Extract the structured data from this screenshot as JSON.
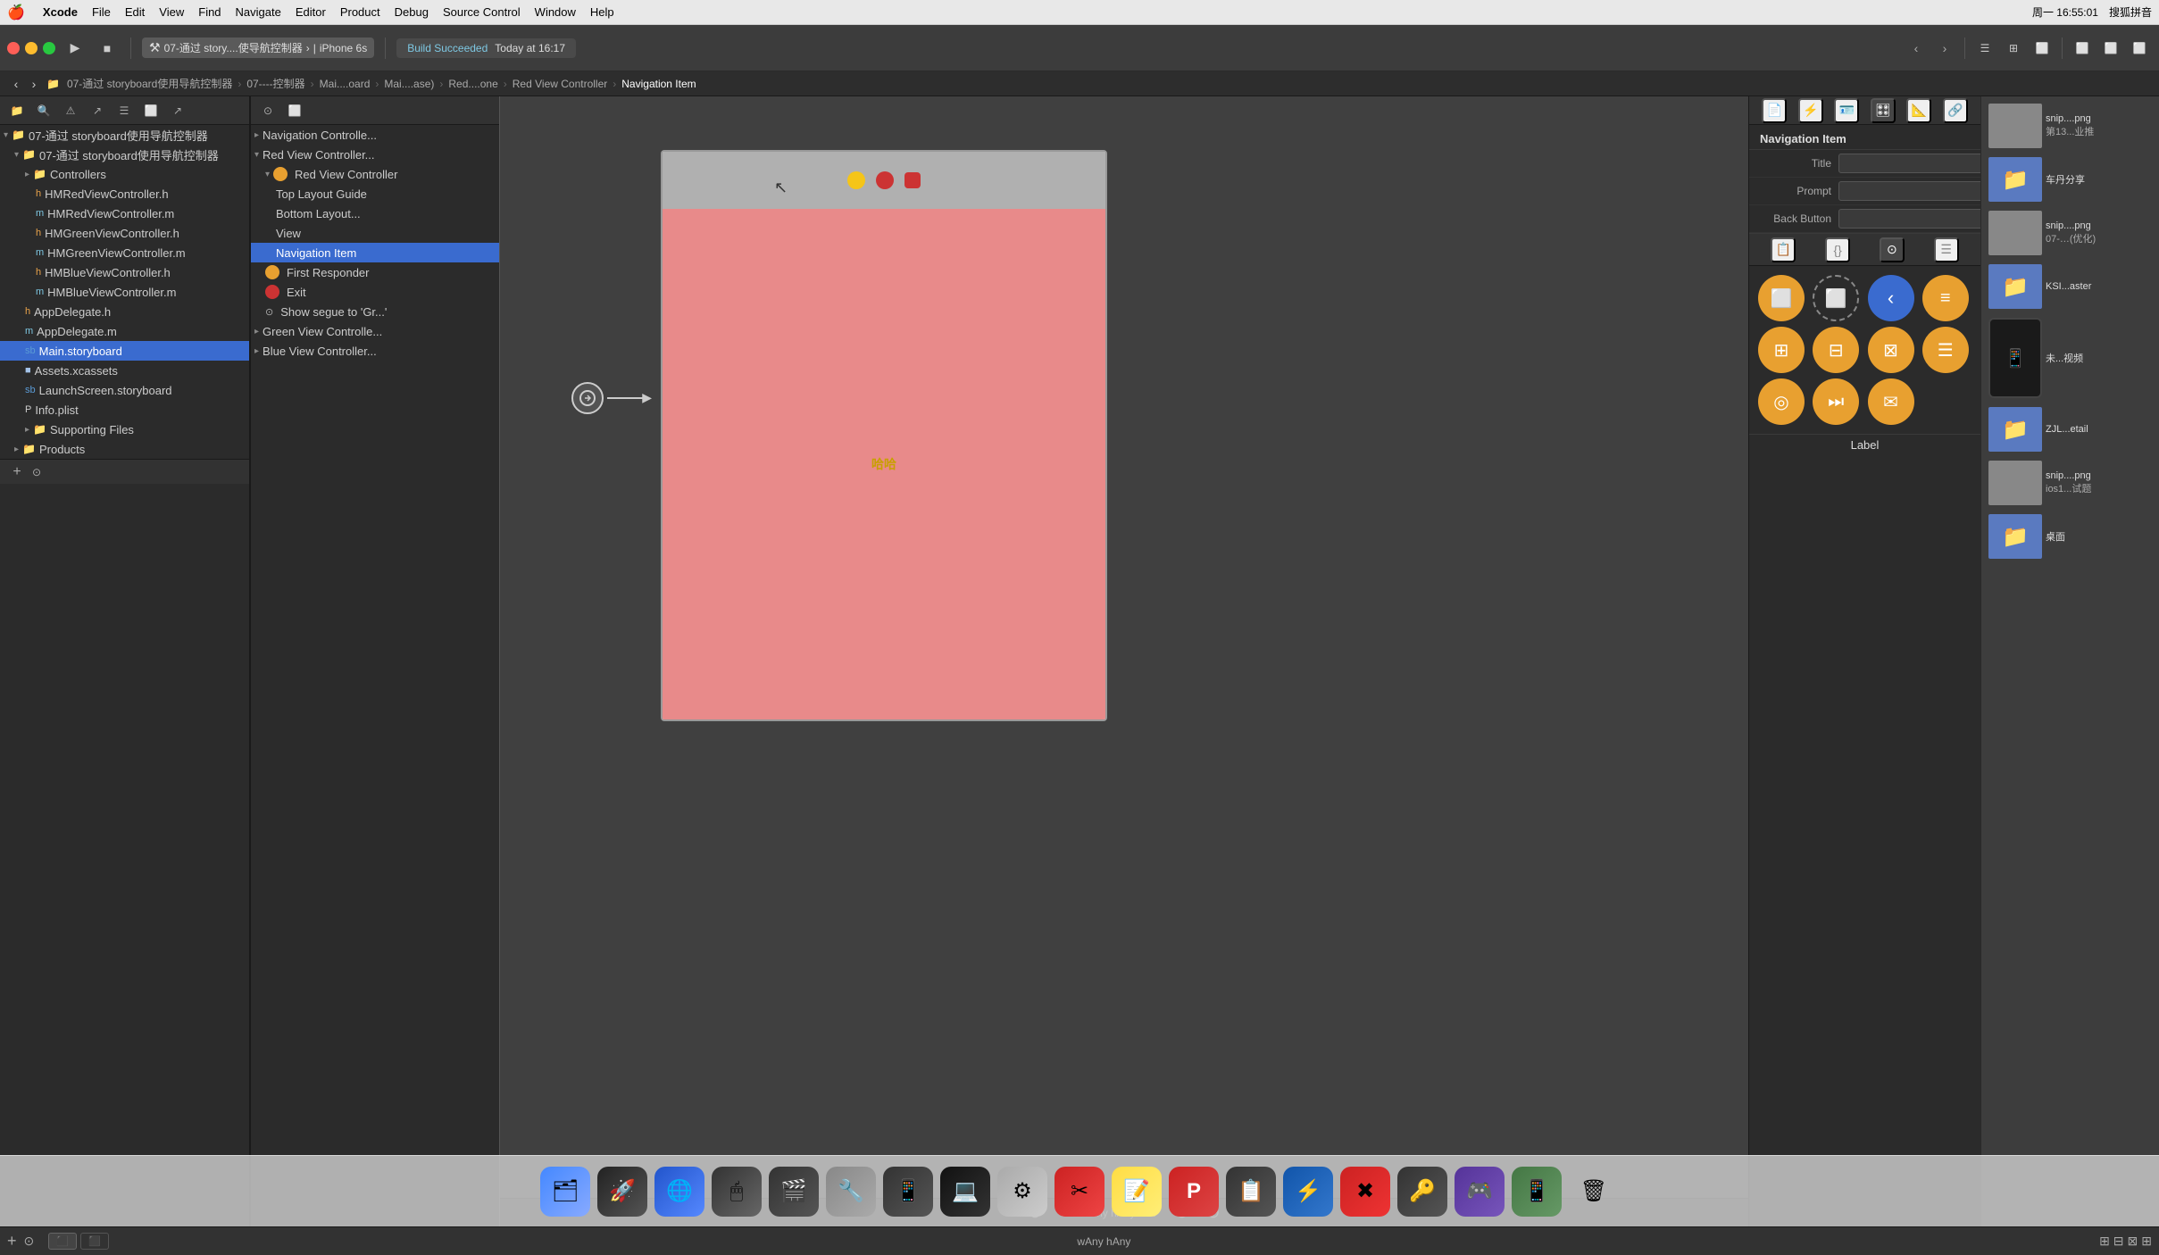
{
  "menubar": {
    "apple": "🍎",
    "items": [
      "Xcode",
      "File",
      "Edit",
      "View",
      "Find",
      "Navigate",
      "Editor",
      "Product",
      "Debug",
      "Source Control",
      "Window",
      "Help"
    ],
    "right": {
      "datetime": "周一 16:55:01",
      "input_method": "搜狐拼音"
    }
  },
  "toolbar": {
    "run_label": "▶",
    "stop_label": "■",
    "scheme": "07-通过 story....使导航控制器",
    "device": "iPhone 6s",
    "build_status": "Build Succeeded",
    "build_time": "Today at 16:17",
    "nav_prev": "‹",
    "nav_next": "›"
  },
  "breadcrumb": {
    "items": [
      "07-通过 storyboard使用导航控制器",
      "07----控制器",
      "Mai....oard",
      "Mai....ase)",
      "Red....one",
      "Red View Controller",
      "Navigation Item"
    ]
  },
  "sidebar": {
    "toolbar_icons": [
      "📁",
      "🔍",
      "⚠",
      "↗",
      "☰",
      "⬜",
      "↗"
    ],
    "tree": [
      {
        "id": "root",
        "label": "07-通过 storyboard使用导航控制器",
        "indent": 0,
        "type": "project",
        "expanded": true
      },
      {
        "id": "group1",
        "label": "07-通过 storyboard使用导航控制器",
        "indent": 1,
        "type": "group",
        "expanded": true
      },
      {
        "id": "controllers",
        "label": "Controllers",
        "indent": 2,
        "type": "group",
        "expanded": false
      },
      {
        "id": "hmred-h",
        "label": "HMRedViewController.h",
        "indent": 3,
        "type": "h"
      },
      {
        "id": "hmred-m",
        "label": "HMRedViewController.m",
        "indent": 3,
        "type": "m"
      },
      {
        "id": "hmgreen-h",
        "label": "HMGreenViewController.h",
        "indent": 3,
        "type": "h"
      },
      {
        "id": "hmgreen-m",
        "label": "HMGreenViewController.m",
        "indent": 3,
        "type": "m"
      },
      {
        "id": "hmblue-h",
        "label": "HMBlueViewController.h",
        "indent": 3,
        "type": "h"
      },
      {
        "id": "hmblue-m",
        "label": "HMBlueViewController.m",
        "indent": 3,
        "type": "m"
      },
      {
        "id": "appdelegate-h",
        "label": "AppDelegate.h",
        "indent": 2,
        "type": "h"
      },
      {
        "id": "appdelegate-m",
        "label": "AppDelegate.m",
        "indent": 2,
        "type": "m"
      },
      {
        "id": "main-storyboard",
        "label": "Main.storyboard",
        "indent": 2,
        "type": "storyboard",
        "selected": true
      },
      {
        "id": "assets",
        "label": "Assets.xcassets",
        "indent": 2,
        "type": "xcassets"
      },
      {
        "id": "launch-storyboard",
        "label": "LaunchScreen.storyboard",
        "indent": 2,
        "type": "storyboard"
      },
      {
        "id": "info-plist",
        "label": "Info.plist",
        "indent": 2,
        "type": "plist"
      },
      {
        "id": "supporting",
        "label": "Supporting Files",
        "indent": 2,
        "type": "group",
        "expanded": false
      },
      {
        "id": "products",
        "label": "Products",
        "indent": 1,
        "type": "group",
        "expanded": false
      }
    ]
  },
  "scene_tree": {
    "items": [
      {
        "id": "nav-controller",
        "label": "Navigation Controlle...",
        "indent": 0,
        "type": "controller",
        "expanded": false
      },
      {
        "id": "red-view-controller-group",
        "label": "Red View Controller...",
        "indent": 0,
        "type": "controller",
        "expanded": true
      },
      {
        "id": "red-view-controller",
        "label": "Red View Controller",
        "indent": 1,
        "type": "scene",
        "dot": "orange"
      },
      {
        "id": "top-layout",
        "label": "Top Layout Guide",
        "indent": 2,
        "type": "layout"
      },
      {
        "id": "bottom-layout",
        "label": "Bottom Layout...",
        "indent": 2,
        "type": "layout"
      },
      {
        "id": "view",
        "label": "View",
        "indent": 2,
        "type": "view"
      },
      {
        "id": "nav-item",
        "label": "Navigation Item",
        "indent": 2,
        "type": "navitem",
        "selected": true
      },
      {
        "id": "first-responder",
        "label": "First Responder",
        "indent": 1,
        "type": "responder",
        "dot": "orange"
      },
      {
        "id": "exit",
        "label": "Exit",
        "indent": 1,
        "type": "exit",
        "dot": "red"
      },
      {
        "id": "show-segue",
        "label": "Show segue to 'Gr...'",
        "indent": 1,
        "type": "segue"
      },
      {
        "id": "green-controller",
        "label": "Green View Controlle...",
        "indent": 0,
        "type": "controller",
        "expanded": false
      },
      {
        "id": "blue-controller",
        "label": "Blue View Controller...",
        "indent": 0,
        "type": "controller",
        "expanded": false
      }
    ]
  },
  "inspector": {
    "title": "Navigation Item",
    "fields": [
      {
        "label": "Title",
        "value": ""
      },
      {
        "label": "Prompt",
        "value": ""
      },
      {
        "label": "Back Button",
        "value": ""
      }
    ]
  },
  "storyboard": {
    "device_circles": [
      "🟡",
      "🔴",
      "🟥"
    ],
    "chinese_text": "哈哈",
    "bottom_labels": [
      "wAny",
      "hAny"
    ]
  },
  "component_panel": {
    "toolbar_icons": [
      "📋",
      "{}",
      "⊙",
      "☰"
    ],
    "row1": [
      {
        "shape": "circle_solid",
        "color": "#e8a030",
        "icon": "⬜"
      },
      {
        "shape": "circle_dashed",
        "color": "transparent",
        "icon": "⬜"
      },
      {
        "shape": "circle_blue_arrow",
        "color": "#3a6bcf",
        "icon": "‹"
      }
    ],
    "row2": [
      {
        "shape": "circle_grid",
        "color": "#e8a030",
        "icon": "⊞"
      },
      {
        "shape": "circle_orange2",
        "color": "#e8a030",
        "icon": "⊟"
      },
      {
        "shape": "circle_orange3",
        "color": "#e8a030",
        "icon": "☰"
      }
    ],
    "row3": [
      {
        "shape": "circle_orange4",
        "color": "#e8a030",
        "icon": "◎"
      },
      {
        "shape": "circle_orange5",
        "color": "#e8a030",
        "icon": "⏭"
      },
      {
        "shape": "circle_envelope",
        "color": "#e8a030",
        "icon": "✉"
      }
    ],
    "bottom_label": "Label"
  },
  "desktop_items": [
    {
      "label": "snip....png",
      "sublabel": "第13...业推"
    },
    {
      "label": "snip....png",
      "sublabel": "车丹分享"
    },
    {
      "label": "snip....png",
      "sublabel": "07-…(优化)"
    },
    {
      "label": "snip....png",
      "sublabel": "KSI...aster"
    },
    {
      "label": "未...视频"
    },
    {
      "label": "ZJL...etail"
    },
    {
      "label": "ios1...试题"
    },
    {
      "label": "桌面"
    }
  ],
  "bottom_bar": {
    "left_items": [
      "+",
      "🔄"
    ],
    "right_items": [
      "⊞",
      "⬜"
    ],
    "center_size": "wAny hAny"
  },
  "dock": {
    "items": [
      "🗂",
      "🚀",
      "🌐",
      "🖱",
      "🎬",
      "🔧",
      "📱",
      "⚙",
      "✂",
      "📝",
      "P",
      "💻",
      "📟",
      "📋",
      "⚡",
      "🔑",
      "🔒",
      "🗑"
    ]
  }
}
